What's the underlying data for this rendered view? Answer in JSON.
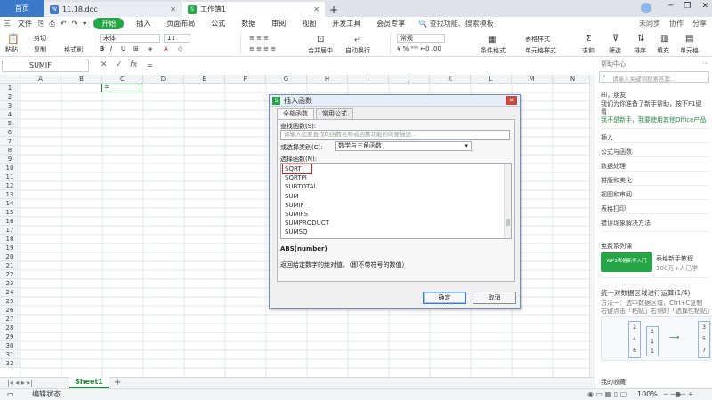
{
  "tabs": {
    "home": "首页",
    "doc": "11.18.doc",
    "workbook": "工作簿1",
    "plus": "+"
  },
  "window": {
    "minimize": "─",
    "restore": "❐",
    "close": "✕"
  },
  "menu": {
    "items_left": [
      "三",
      "文件",
      "⎘",
      "⎙",
      "↶",
      "↷",
      "▾"
    ],
    "start": "开始",
    "items": [
      "插入",
      "页面布局",
      "公式",
      "数据",
      "审阅",
      "视图",
      "开发工具",
      "会员专享"
    ],
    "search": "🔍 查找功能、搜索模板",
    "right": [
      "未同步",
      "协作",
      "分享"
    ]
  },
  "ribbon": {
    "paste": "粘贴",
    "cut": "剪切",
    "copy": "复制",
    "format_painter": "格式刷",
    "font": "宋体",
    "size": "11",
    "merge": "合并居中",
    "wrap": "自动换行",
    "number_format": "常规",
    "cond_format": "条件格式",
    "table_style": "表格样式",
    "cell_style": "单元格样式",
    "sum": "求和",
    "filter": "筛选",
    "sort": "排序",
    "fill": "填充",
    "cells": "单元格"
  },
  "formula": {
    "cell_ref": "SUMIF",
    "cancel": "✕",
    "accept": "✓",
    "fx": "fx",
    "value": "="
  },
  "grid": {
    "columns": [
      "A",
      "B",
      "C",
      "D",
      "E",
      "F",
      "G",
      "H",
      "I",
      "J",
      "K",
      "L",
      "M",
      "N"
    ],
    "rows": [
      "1",
      "2",
      "3",
      "4",
      "5",
      "6",
      "7",
      "8",
      "9",
      "10",
      "11",
      "12",
      "13",
      "14",
      "15",
      "16",
      "17",
      "18",
      "19",
      "20",
      "21",
      "22",
      "23",
      "24",
      "25",
      "26",
      "27",
      "28",
      "29",
      "30",
      "31",
      "32"
    ],
    "active_cell_value": "="
  },
  "sheetbar": {
    "sheet": "Sheet1",
    "add": "+"
  },
  "status": {
    "mode": "编辑状态",
    "zoom": "100%"
  },
  "help": {
    "title": "帮助中心",
    "search_placeholder": "请输入关键词搜索答案…",
    "greeting": "Hi，朋友",
    "line1": "我们为你准备了新手帮助，按下F1键",
    "line2": "看",
    "link": "我不是新手，我要使用其他Office产品",
    "categories": [
      "插入",
      "公式与函数",
      "数据处理",
      "排版和美化",
      "视图和审阅",
      "表格打印",
      "错误现象解决方法"
    ],
    "course_title": "免费系列课",
    "course_name": "表格新手教程",
    "course_count": "100万+人已学",
    "course_badge": "WPS表格新手入门",
    "feature_title": "统一对数据区域进行运算(1/4)",
    "feature_desc1": "方法一：选中数据区域，Ctrl+C复制",
    "feature_desc2": "右键点击「粘贴」右侧的「选择性粘贴」",
    "favorites": "我的收藏",
    "nums_a": [
      "2",
      "4",
      "6"
    ],
    "nums_b": [
      "1",
      "1",
      "1"
    ],
    "nums_c": [
      "3",
      "5",
      "7"
    ]
  },
  "dialog": {
    "title": "插入函数",
    "tab_all": "全部函数",
    "tab_common": "常用公式",
    "search_label": "查找函数(S):",
    "search_placeholder": "请输入您要查找的函数名称或函数功能的简要描述...",
    "category_label": "或选择类别(C):",
    "category_value": "数学与三角函数",
    "select_label": "选择函数(N):",
    "functions": [
      "SQRT",
      "SQRTPI",
      "SUBTOTAL",
      "SUM",
      "SUMIF",
      "SUMIFS",
      "SUMPRODUCT",
      "SUMSQ"
    ],
    "signature": "ABS(number)",
    "description": "返回给定数字的绝对值。（即不带符号的数值）",
    "ok": "确定",
    "cancel": "取消"
  },
  "colors": {
    "accent": "#25a546",
    "tab_blue": "#3b78c9",
    "highlight": "#e02020"
  }
}
